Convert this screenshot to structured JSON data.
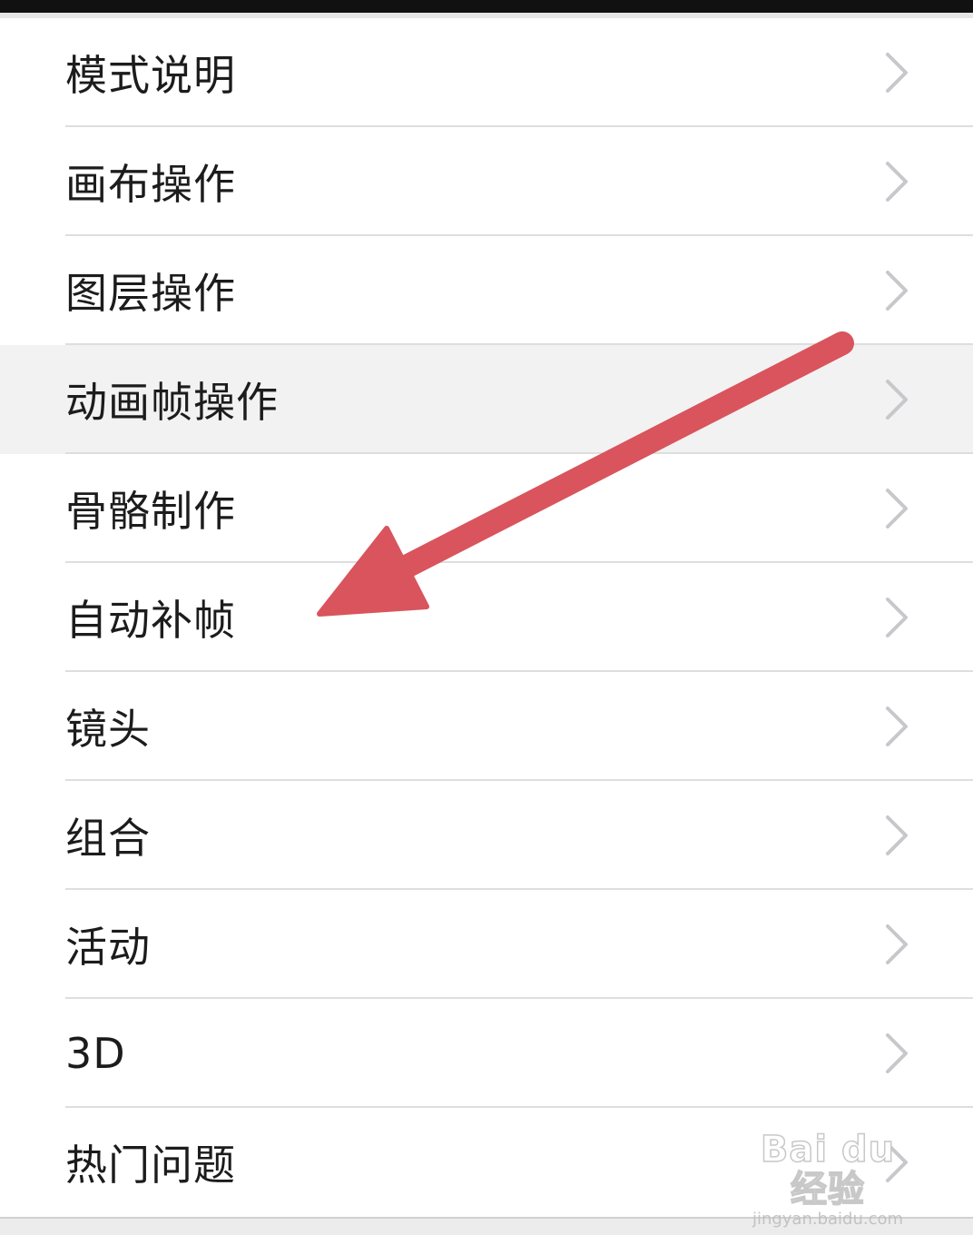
{
  "menu": {
    "items": [
      {
        "label": "模式说明",
        "highlighted": false
      },
      {
        "label": "画布操作",
        "highlighted": false
      },
      {
        "label": "图层操作",
        "highlighted": false
      },
      {
        "label": "动画帧操作",
        "highlighted": true
      },
      {
        "label": "骨骼制作",
        "highlighted": false
      },
      {
        "label": "自动补帧",
        "highlighted": false
      },
      {
        "label": "镜头",
        "highlighted": false
      },
      {
        "label": "组合",
        "highlighted": false
      },
      {
        "label": "活动",
        "highlighted": false
      },
      {
        "label": "3D",
        "highlighted": false
      },
      {
        "label": "热门问题",
        "highlighted": false
      }
    ],
    "chevron_icon": "chevron-right-icon"
  },
  "annotation": {
    "arrow_color": "#d9545c",
    "arrow_icon": "red-arrow-annotation"
  },
  "watermark": {
    "main": "Bai du 经验",
    "url": "jingyan.baidu.com"
  },
  "colors": {
    "background": "#ffffff",
    "highlight_row": "#f2f2f2",
    "divider": "#dedede",
    "chevron": "#c7c7cc",
    "text": "#1c1c1c"
  }
}
